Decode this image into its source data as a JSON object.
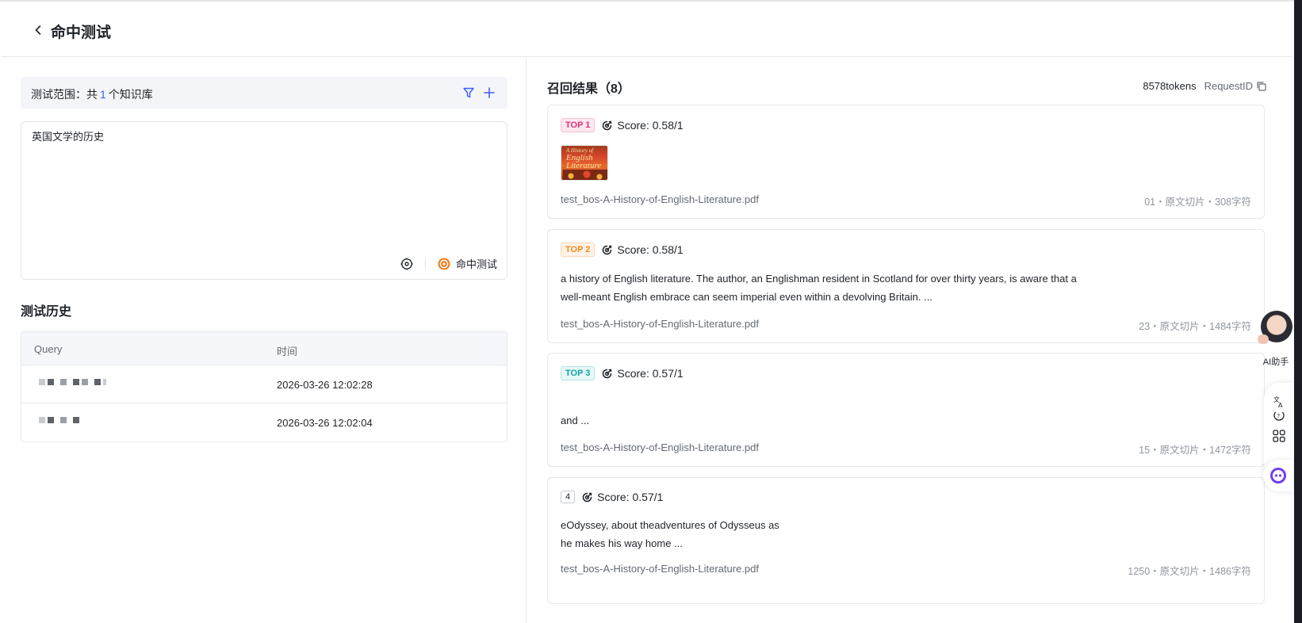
{
  "header": {
    "title": "命中测试"
  },
  "scope": {
    "prefix": "测试范围：共",
    "count": "1",
    "suffix": "个知识库"
  },
  "query": {
    "text": "英国文学的历史",
    "hit_button": "命中测试"
  },
  "history": {
    "title": "测试历史",
    "columns": [
      "Query",
      "时间"
    ],
    "rows": [
      {
        "time": "2026-03-26 12:02:28"
      },
      {
        "time": "2026-03-26 12:02:04"
      }
    ]
  },
  "results": {
    "title": "召回结果（8）",
    "tokens": "8578tokens",
    "request_id_label": "RequestID",
    "items": [
      {
        "rank": "TOP 1",
        "score": "Score: 0.58/1",
        "image_caption": [
          "A History of",
          "English",
          "Literature"
        ],
        "text": [],
        "file": "test_bos-A-History-of-English-Literature.pdf",
        "meta": "01・原文切片・308字符"
      },
      {
        "rank": "TOP 2",
        "score": "Score: 0.58/1",
        "text": [
          " a history of English literature. The author, an Englishman resident in Scotland for over thirty years, is aware that a",
          "well-meant English embrace can seem imperial even within a devolving Britain. ..."
        ],
        "file": "test_bos-A-History-of-English-Literature.pdf",
        "meta": "23・原文切片・1484字符"
      },
      {
        "rank": "TOP 3",
        "score": "Score: 0.57/1",
        "text": [
          "and ..."
        ],
        "file": "test_bos-A-History-of-English-Literature.pdf",
        "meta": "15・原文切片・1472字符"
      },
      {
        "rank": "4",
        "score": "Score: 0.57/1",
        "text": [
          "eOdyssey, about theadventures of Odysseus as",
          "he makes his way home ..."
        ],
        "file": "test_bos-A-History-of-English-Literature.pdf",
        "meta": "1250・原文切片・1486字符"
      }
    ]
  },
  "assistant": {
    "label": "AI助手"
  },
  "colors": {
    "accent": "#3d5afe",
    "hit_orange": "#f07b1d",
    "top1": "#e0337a",
    "top2": "#f08a24",
    "top3": "#16a3a6"
  }
}
